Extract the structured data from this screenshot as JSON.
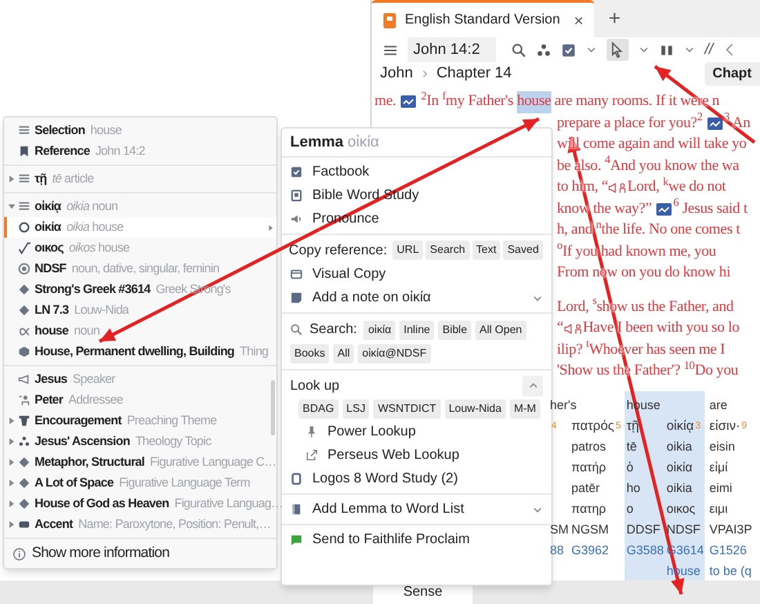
{
  "tab": {
    "title": "English Standard Version",
    "close": "×",
    "new": "+"
  },
  "toolbar": {
    "reference": "John 14:2",
    "parallel": "//"
  },
  "breadcrumb": [
    "John",
    "Chapter 14"
  ],
  "chapter_button": "Chapt",
  "paragraphs": [
    [
      [
        {
          "kind": "text",
          "text": "me. "
        },
        {
          "kind": "media"
        },
        {
          "kind": "text",
          "text": " $^{2}$In $^{f}$my Father's "
        },
        {
          "kind": "highlight",
          "text": "house"
        },
        {
          "kind": "text",
          "text": " are many rooms. If it were n"
        }
      ],
      [
        {
          "kind": "text",
          "text": "prepare a place for you?$^{2}$ "
        },
        {
          "kind": "media"
        },
        {
          "kind": "text",
          "text": "$^{3}$ An"
        }
      ],
      [
        {
          "kind": "text",
          "text": "will come again and will take yo"
        }
      ],
      [
        {
          "kind": "text",
          "text": "be also. $^{4}$And you know the wa"
        }
      ],
      [
        {
          "kind": "text",
          "text": "to him, “"
        },
        {
          "kind": "speaker"
        },
        {
          "kind": "text",
          "text": "Lord, $^{k}$we do not"
        }
      ],
      [
        {
          "kind": "text",
          "text": "know the way?” "
        },
        {
          "kind": "media"
        },
        {
          "kind": "text",
          "text": "$^{6}$ Jesus said t"
        }
      ],
      [
        {
          "kind": "text",
          "text": "h, and $^{n}$the life. No one comes t"
        }
      ],
      [
        {
          "kind": "text",
          "text": "$^{o}$If you had known me, you"
        }
      ],
      [
        {
          "kind": "text",
          "text": "From now on you do know hi"
        }
      ]
    ],
    [
      [
        {
          "kind": "text",
          "text": "Lord, $^{s}$show us the Father, and"
        }
      ],
      [
        {
          "kind": "text",
          "text": "“"
        },
        {
          "kind": "speaker"
        },
        {
          "kind": "text",
          "text": "Have I been with you so lo"
        }
      ],
      [
        {
          "kind": "text",
          "text": "ilip? $^{t}$Whoever has seen me I"
        }
      ],
      [
        {
          "kind": "text",
          "text": "'Show us the Father'? $^{10}$Do you"
        }
      ]
    ]
  ],
  "interlinear": [
    {
      "header": "her's",
      "selected": false,
      "columns": [
        {
          "index": "4",
          "morph": "SM",
          "strongs": "88"
        },
        {
          "word": "πατρός",
          "index": "5",
          "lines": [
            "patros",
            "πατήρ",
            "patēr",
            "πατηρ"
          ],
          "morph": "NGSM",
          "strongs": "G3962"
        }
      ]
    },
    {
      "header": "house",
      "selected": true,
      "columns": [
        {
          "word": "τῇ",
          "lines": [
            "tē",
            "ὁ",
            "ho",
            "ο"
          ],
          "morph": "DDSF",
          "strongs": "G3588"
        },
        {
          "word": "οἰκίᾳ",
          "index": "3",
          "lines": [
            "oikia",
            "οἰκία",
            "oikia",
            "οικος"
          ],
          "morph": "NDSF",
          "strongs": "G3614",
          "sense": "house"
        }
      ]
    },
    {
      "header": "are",
      "selected": false,
      "columns": [
        {
          "word": "εἰσιν·",
          "index": "9",
          "lines": [
            "eisin",
            "εἰμί",
            "eimi",
            "ειμι"
          ],
          "morph": "VPAI3P",
          "strongs": "G1526",
          "sense": "to be (q"
        }
      ]
    }
  ],
  "row_label": "Sense",
  "info_menu": {
    "sections": [
      [
        {
          "kind": "selection",
          "label": "Selection",
          "detail": "house",
          "selected": false
        },
        {
          "kind": "reference",
          "label": "Reference",
          "detail": "John 14:2",
          "selected": false
        }
      ],
      [
        {
          "kind": "word",
          "label": "τῇ",
          "detail": "*tē* article",
          "expanded": false,
          "selected": false
        }
      ],
      [
        {
          "kind": "word",
          "label": "οἰκίᾳ",
          "detail": "*oikia* noun",
          "expanded": true,
          "selected": false
        },
        {
          "kind": "lemma",
          "label": "οἰκία",
          "detail": "*oikia* house",
          "selected": true
        },
        {
          "kind": "root",
          "label": "οικος",
          "detail": "*oikos* house",
          "selected": false
        },
        {
          "kind": "morph",
          "label": "NDSF",
          "detail": "noun, dative, singular, feminin",
          "selected": false
        },
        {
          "kind": "strongs",
          "label": "Strong's Greek #3614",
          "detail": "Greek Strong's",
          "selected": false
        },
        {
          "kind": "louw-nida",
          "label": "LN 7.3",
          "detail": "Louw-Nida",
          "selected": false
        },
        {
          "kind": "sense",
          "label": "house",
          "detail": "noun",
          "selected": false
        },
        {
          "kind": "thing",
          "label": "House, Permanent dwelling, Building",
          "detail": "Thing",
          "selected": false
        }
      ],
      [
        {
          "kind": "speaker",
          "label": "Jesus",
          "detail": "Speaker",
          "selected": false
        },
        {
          "kind": "addressee",
          "label": "Peter",
          "detail": "Addressee",
          "selected": false
        },
        {
          "kind": "theme",
          "label": "Encouragement",
          "detail": "Preaching Theme",
          "expanded": false,
          "selected": false
        },
        {
          "kind": "topic",
          "label": "Jesus' Ascension",
          "detail": "Theology Topic",
          "expanded": false,
          "selected": false
        },
        {
          "kind": "figure",
          "label": "Metaphor, Structural",
          "detail": "Figurative Language C…",
          "expanded": false,
          "selected": false
        },
        {
          "kind": "figure",
          "label": "A Lot of Space",
          "detail": "Figurative Language Term",
          "expanded": false,
          "selected": false
        },
        {
          "kind": "figure",
          "label": "House of God as Heaven",
          "detail": "Figurative Languag…",
          "expanded": false,
          "selected": false
        },
        {
          "kind": "accent",
          "label": "Accent",
          "detail": "Name: Paroxytone, Position: Penult,…",
          "expanded": false,
          "selected": false
        }
      ]
    ],
    "footer": "Show more information"
  },
  "lemma_menu": {
    "title": "Lemma",
    "lemma": "οἰκία",
    "sections": [
      [
        {
          "kind": "factbook",
          "label": "Factbook"
        },
        {
          "kind": "word-study",
          "label": "Bible Word Study"
        },
        {
          "kind": "pronounce",
          "label": "Pronounce"
        }
      ],
      [
        {
          "kind": "copy-reference",
          "label": "Copy reference:",
          "options": [
            "URL",
            "Search",
            "Text",
            "Saved"
          ]
        },
        {
          "kind": "visual-copy",
          "label": "Visual Copy"
        },
        {
          "kind": "note",
          "label": "Add a note on οἰκία",
          "expanded": false
        }
      ],
      [
        {
          "kind": "search",
          "label": "Search:",
          "options": [
            "οἰκία",
            "Inline",
            "Bible",
            "All Open",
            "Books",
            "All",
            "οἰκία@NDSF"
          ]
        }
      ],
      [
        {
          "kind": "lookup",
          "label": "Look up",
          "expanded": true,
          "options": [
            "BDAG",
            "LSJ",
            "WSNTDICT",
            "Louw-Nida",
            "M-M"
          ]
        },
        {
          "kind": "power-lookup",
          "label": "Power Lookup"
        },
        {
          "kind": "web-lookup",
          "label": "Perseus Web Lookup"
        },
        {
          "kind": "logos-word-study",
          "label": "Logos 8 Word Study (2)"
        }
      ],
      [
        {
          "kind": "word-list",
          "label": "Add Lemma to Word List",
          "expanded": false
        }
      ],
      [
        {
          "kind": "proclaim",
          "label": "Send to Faithlife Proclaim"
        }
      ]
    ]
  }
}
